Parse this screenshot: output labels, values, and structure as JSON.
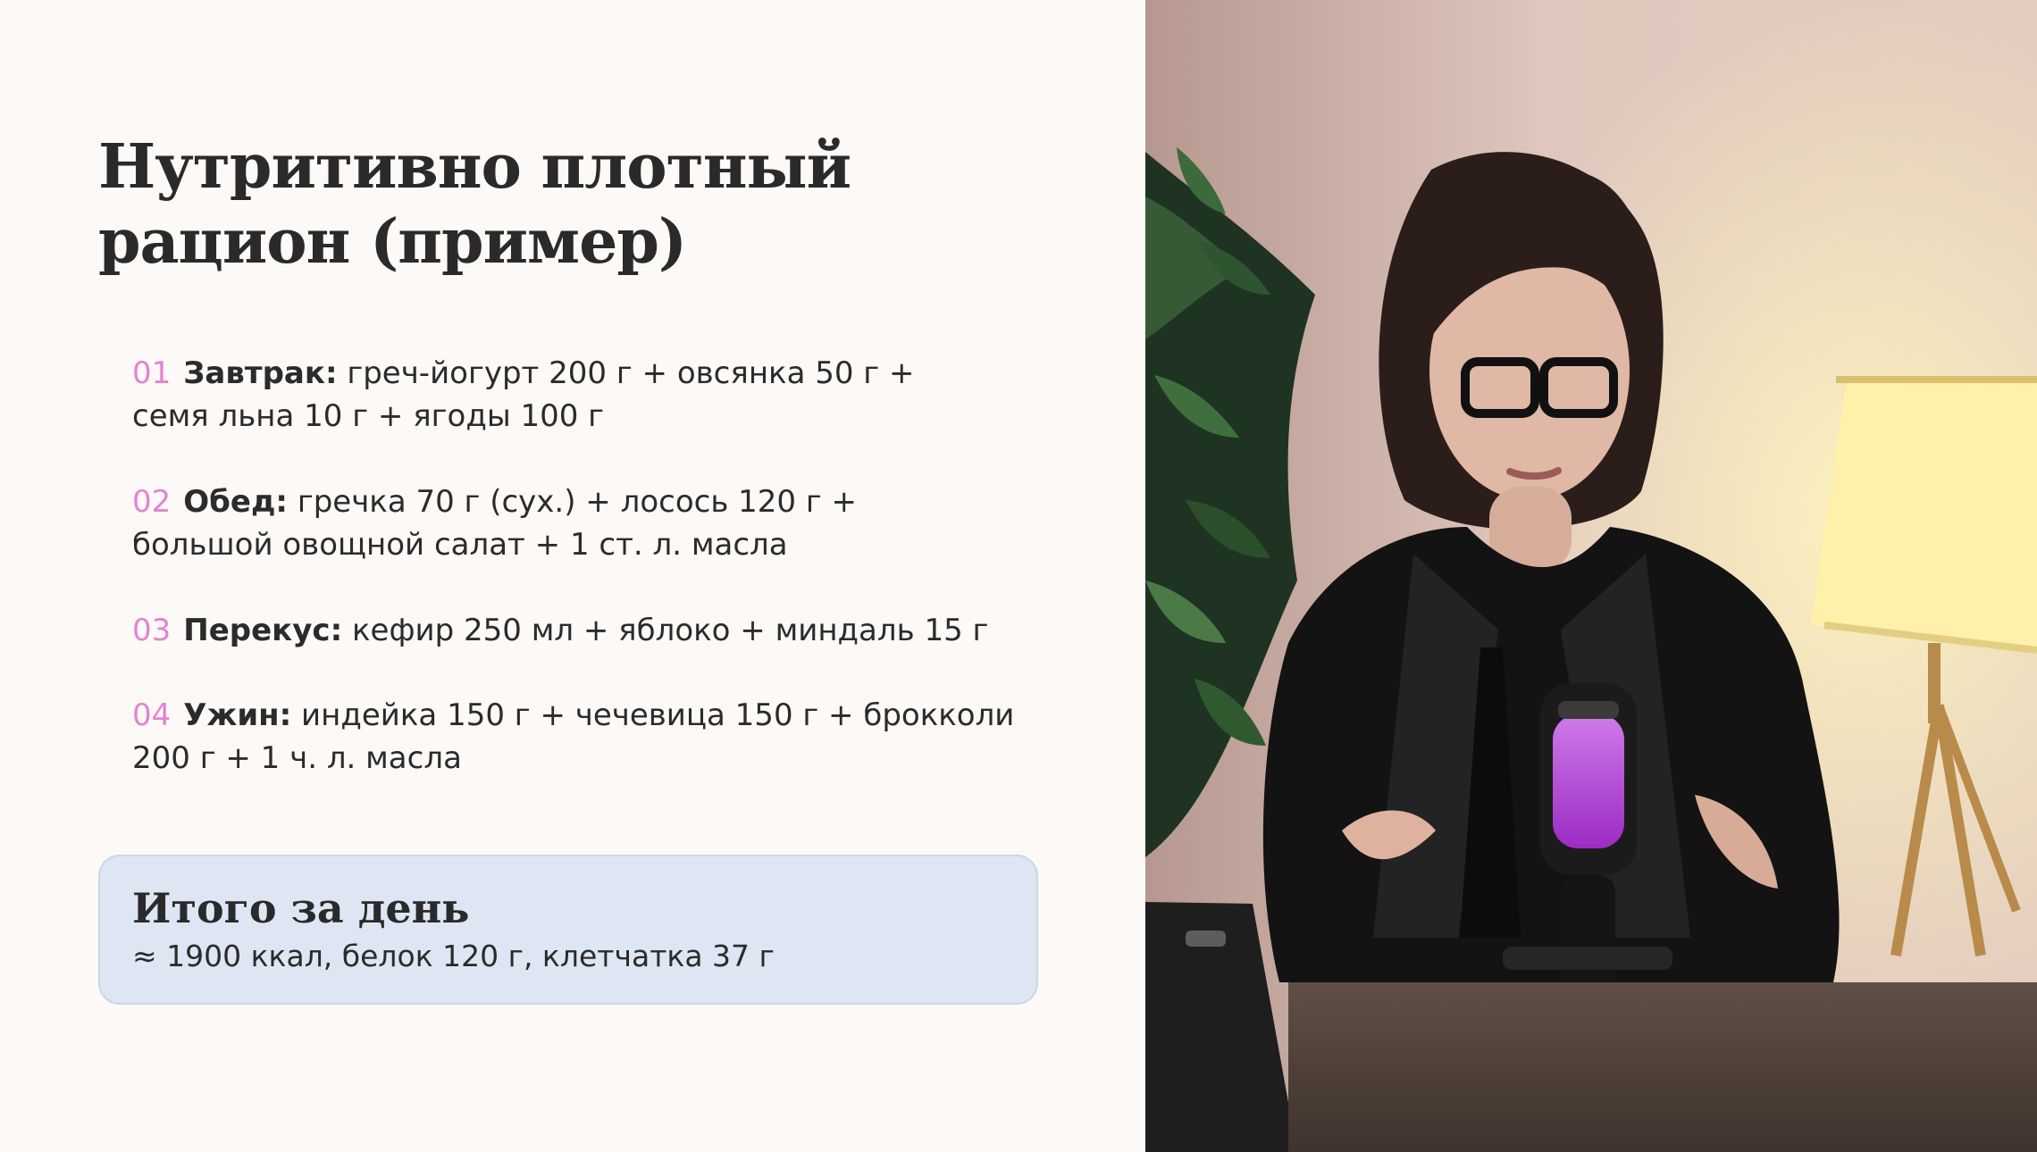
{
  "slide": {
    "title_line1": "Нутритивно плотный",
    "title_line2": "рацион (пример)",
    "meals": [
      {
        "num": "01",
        "label": "Завтрак:",
        "line1": "греч-йогурт 200 г + овсянка 50 г +",
        "line2": "семя льна 10 г + ягоды 100 г"
      },
      {
        "num": "02",
        "label": "Обед:",
        "line1": "гречка 70 г (сух.) + лосось 120 г +",
        "line2": "большой овощной салат + 1 ст. л. масла"
      },
      {
        "num": "03",
        "label": "Перекус:",
        "line1": "кефир 250 мл + яблоко + миндаль 15 г",
        "line2": ""
      },
      {
        "num": "04",
        "label": "Ужин:",
        "line1": "индейка 150 г + чечевица 150 г + брокколи",
        "line2": "200 г + 1 ч. л. масла"
      }
    ],
    "summary": {
      "title": "Итого за день",
      "text": "≈ 1900 ккал, белок 120 г, клетчатка 37 г"
    }
  },
  "colors": {
    "background": "#fcf9f6",
    "number_accent": "#e583d0",
    "summary_box": "#dfe6f3",
    "text": "#2b2b2b"
  }
}
